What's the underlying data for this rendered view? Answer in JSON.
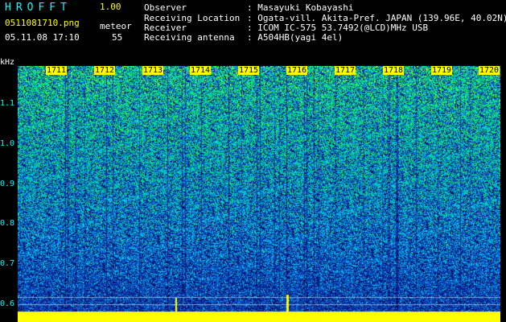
{
  "header": {
    "logo": "HROFFT",
    "version": "1.00",
    "filename": "0511081710.png",
    "meteor_label": "meteor",
    "datetime": "05.11.08 17:10",
    "meteor_count": "55",
    "info": [
      {
        "label": "Observer",
        "value": ": Masayuki Kobayashi"
      },
      {
        "label": "Receiving Location",
        "value": ": Ogata-vill. Akita-Pref. JAPAN (139.96E, 40.02N)"
      },
      {
        "label": "Receiver",
        "value": ": ICOM IC-575 53.7492(@LCD)MHz USB"
      },
      {
        "label": "Receiving antenna",
        "value": ": A504HB(yagi 4el)"
      }
    ]
  },
  "axis": {
    "y_unit": "kHz",
    "y_ticks": [
      "1.1",
      "1.0",
      "0.9",
      "0.8",
      "0.7",
      "0.6"
    ],
    "x_ticks": [
      "1711",
      "1712",
      "1713",
      "1714",
      "1715",
      "1716",
      "1717",
      "1718",
      "1719",
      "1720"
    ]
  },
  "colors": {
    "background": "#000000",
    "label_text": "#00ffff",
    "value_text": "#ffff00",
    "spectrum_low": "#0a1f8a",
    "spectrum_mid": "#0080ff",
    "spectrum_high": "#00ff80",
    "spectrum_peak": "#ffff00"
  }
}
